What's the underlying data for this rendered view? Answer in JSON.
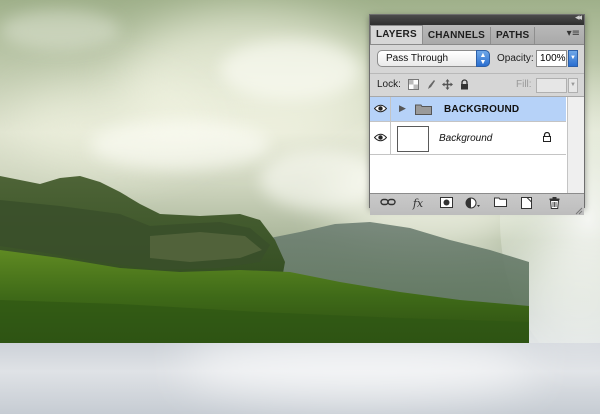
{
  "panel": {
    "tabs": [
      {
        "label": "LAYERS",
        "active": true
      },
      {
        "label": "CHANNELS",
        "active": false
      },
      {
        "label": "PATHS",
        "active": false
      }
    ],
    "collapse_glyph": "◂◂",
    "menu_glyph": "▾≡",
    "blend_mode": "Pass Through",
    "opacity_label": "Opacity:",
    "opacity_value": "100%",
    "lock_label": "Lock:",
    "fill_label": "Fill:",
    "layers": [
      {
        "name": "BACKGROUND",
        "type": "group",
        "visible": true,
        "selected": true
      },
      {
        "name": "Background",
        "type": "layer",
        "visible": true,
        "selected": false,
        "locked": true
      }
    ],
    "footer_icons": [
      "link-layers-icon",
      "fx-icon",
      "mask-icon",
      "adjustment-icon",
      "new-group-icon",
      "new-layer-icon",
      "trash-icon"
    ],
    "accent_color": "#b6d2f8",
    "select_arrow_color": "#2a6ed0"
  }
}
